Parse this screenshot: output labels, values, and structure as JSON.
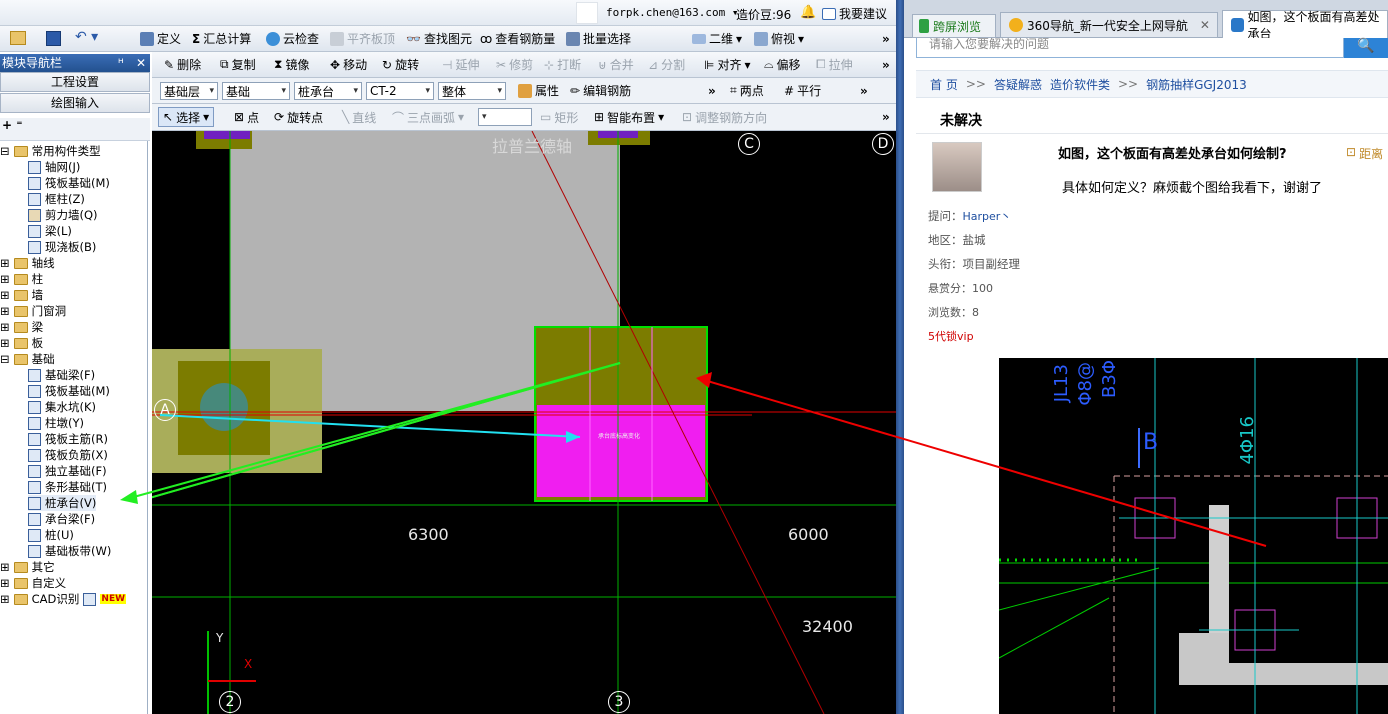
{
  "top": {
    "email": "forpk.chen@163.com",
    "beans": "造价豆:96",
    "suggest": "我要建议"
  },
  "left_title": "模块导航栏",
  "left_buttons": [
    "工程设置",
    "绘图输入"
  ],
  "toolbar1": [
    "定义",
    "汇总计算",
    "云检查",
    "平齐板顶",
    "查找图元",
    "查看钢筋量",
    "批量选择",
    "二维",
    "俯视"
  ],
  "toolbar2": [
    "删除",
    "复制",
    "镜像",
    "移动",
    "旋转",
    "延伸",
    "修剪",
    "打断",
    "合并",
    "分割",
    "对齐",
    "偏移",
    "拉伸"
  ],
  "toolbar3": {
    "layer": "基础层",
    "cat": "基础",
    "type": "桩承台",
    "name": "CT-2",
    "whole": "整体",
    "props": "属性",
    "edit": "编辑钢筋",
    "twopt": "两点",
    "parallel": "平行"
  },
  "toolbar4": [
    "选择",
    "点",
    "旋转点",
    "直线",
    "三点画弧",
    "矩形",
    "智能布置",
    "调整钢筋方向"
  ],
  "tree": {
    "common": "常用构件类型",
    "common_items": [
      "轴网(J)",
      "筏板基础(M)",
      "框柱(Z)",
      "剪力墙(Q)",
      "梁(L)",
      "现浇板(B)"
    ],
    "groups": [
      "轴线",
      "柱",
      "墙",
      "门窗洞",
      "梁",
      "板",
      "基础"
    ],
    "foundation_items": [
      "基础梁(F)",
      "筏板基础(M)",
      "集水坑(K)",
      "柱墩(Y)",
      "筏板主筋(R)",
      "筏板负筋(X)",
      "独立基础(F)",
      "条形基础(T)",
      "桩承台(V)",
      "承台梁(F)",
      "桩(U)",
      "基础板带(W)"
    ],
    "tail": [
      "其它",
      "自定义",
      "CAD识别"
    ],
    "new_badge": "NEW"
  },
  "canvas": {
    "axis_label": "拉普兰德轴",
    "dims": [
      "6300",
      "6000",
      "32400"
    ],
    "circles": [
      "C",
      "D",
      "A",
      "2",
      "3"
    ],
    "coord": [
      "Y",
      "X"
    ],
    "mini_text": "承台底标高变化"
  },
  "browser": {
    "tabs": [
      "跨屏浏览",
      "360导航_新一代安全上网导航",
      "如图，这个板面有高差处承台"
    ],
    "search": "请输入您要解决的问题",
    "breadcrumb": [
      "首 页",
      ">>",
      "答疑解惑",
      "造价软件类",
      ">>",
      "钢筋抽样GGJ2013"
    ],
    "status": "未解决",
    "title": "如图，这个板面有高差处承台如何绘制?",
    "dist": "距离",
    "body": "具体如何定义？麻烦截个图给我看下，谢谢了",
    "fields": [
      {
        "k": "提问：",
        "v": "Harper丶"
      },
      {
        "k": "地区：",
        "v": "盐城"
      },
      {
        "k": "头衔：",
        "v": "项目副经理"
      },
      {
        "k": "悬赏分：",
        "v": "100"
      },
      {
        "k": "浏览数：",
        "v": "8"
      }
    ],
    "vip": "5代锁vip",
    "cad_texts": [
      "JL13",
      "Φ8@",
      "B3Φ",
      "B",
      "4Φ16"
    ]
  }
}
